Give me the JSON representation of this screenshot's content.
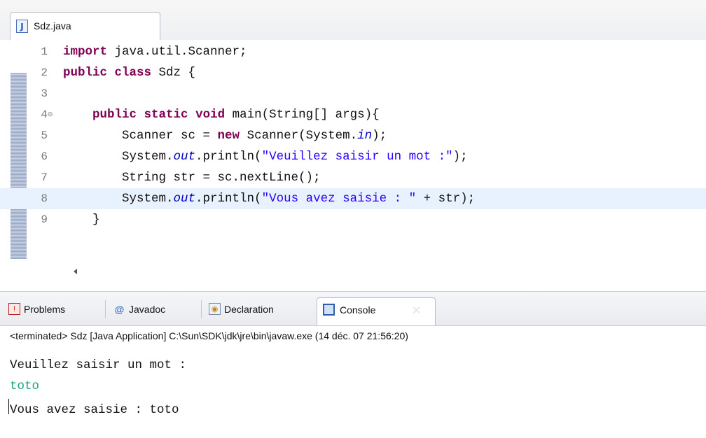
{
  "editor": {
    "tab_label": "Sdz.java",
    "file_icon": "J",
    "lines": [
      {
        "n": "1",
        "segs": [
          {
            "t": "import",
            "c": "kw"
          },
          {
            "t": " java.util.Scanner;",
            "c": ""
          }
        ]
      },
      {
        "n": "2",
        "segs": [
          {
            "t": "public",
            "c": "kw"
          },
          {
            "t": " ",
            "c": ""
          },
          {
            "t": "class",
            "c": "kw"
          },
          {
            "t": " Sdz {",
            "c": ""
          }
        ]
      },
      {
        "n": "3",
        "segs": []
      },
      {
        "n": "4",
        "fold": true,
        "segs": [
          {
            "t": "    ",
            "c": ""
          },
          {
            "t": "public",
            "c": "kw"
          },
          {
            "t": " ",
            "c": ""
          },
          {
            "t": "static",
            "c": "kw"
          },
          {
            "t": " ",
            "c": ""
          },
          {
            "t": "void",
            "c": "kw"
          },
          {
            "t": " main(String[] args){",
            "c": ""
          }
        ]
      },
      {
        "n": "5",
        "segs": [
          {
            "t": "        Scanner sc = ",
            "c": ""
          },
          {
            "t": "new",
            "c": "kw"
          },
          {
            "t": " Scanner(System.",
            "c": ""
          },
          {
            "t": "in",
            "c": "fld"
          },
          {
            "t": ");",
            "c": ""
          }
        ]
      },
      {
        "n": "6",
        "segs": [
          {
            "t": "        System.",
            "c": ""
          },
          {
            "t": "out",
            "c": "fld"
          },
          {
            "t": ".println(",
            "c": ""
          },
          {
            "t": "\"Veuillez saisir un mot :\"",
            "c": "str"
          },
          {
            "t": ");",
            "c": ""
          }
        ]
      },
      {
        "n": "7",
        "segs": [
          {
            "t": "        String str = sc.nextLine();",
            "c": ""
          }
        ]
      },
      {
        "n": "8",
        "current": true,
        "segs": [
          {
            "t": "        System.",
            "c": ""
          },
          {
            "t": "out",
            "c": "fld"
          },
          {
            "t": ".println(",
            "c": ""
          },
          {
            "t": "\"Vous avez saisie : \"",
            "c": "str"
          },
          {
            "t": " + str);",
            "c": ""
          }
        ]
      },
      {
        "n": "9",
        "segs": [
          {
            "t": "    }",
            "c": ""
          }
        ]
      }
    ]
  },
  "panel": {
    "tabs": [
      {
        "label": "Problems",
        "icon": "problems-icon"
      },
      {
        "label": "Javadoc",
        "icon": "at-icon"
      },
      {
        "label": "Declaration",
        "icon": "declaration-icon"
      },
      {
        "label": "Console",
        "icon": "console-icon"
      }
    ],
    "console_header": "<terminated> Sdz [Java Application] C:\\Sun\\SDK\\jdk\\jre\\bin\\javaw.exe (14 déc. 07 21:56:20)",
    "output": [
      {
        "text": "Veuillez saisir un mot :",
        "kind": "out"
      },
      {
        "text": "toto",
        "kind": "input"
      },
      {
        "text": "Vous avez saisie : toto",
        "kind": "out"
      }
    ]
  },
  "colors": {
    "keyword": "#7f0055",
    "string": "#2a00ff",
    "field": "#0000c0",
    "console_input": "#1aa37e",
    "current_line": "#e8f2fe"
  }
}
